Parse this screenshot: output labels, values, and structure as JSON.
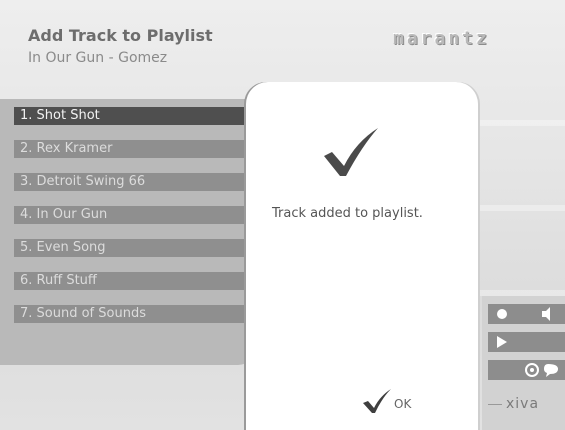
{
  "header": {
    "title": "Add Track to Playlist",
    "subtitle": "In Our Gun - Gomez",
    "brand": "marantz"
  },
  "tracks": [
    {
      "label": "1. Shot Shot",
      "selected": true
    },
    {
      "label": "2. Rex Kramer",
      "selected": false
    },
    {
      "label": "3. Detroit Swing 66",
      "selected": false
    },
    {
      "label": "4. In Our Gun",
      "selected": false
    },
    {
      "label": "5. Even Song",
      "selected": false
    },
    {
      "label": "6. Ruff Stuff",
      "selected": false
    },
    {
      "label": "7. Sound of Sounds",
      "selected": false
    }
  ],
  "dialog": {
    "message": "Track added to playlist.",
    "ok_label": "OK"
  },
  "side_panel": {
    "controls": [
      "record-icon",
      "volume-icon",
      "play-icon",
      "settings-icon",
      "speech-icon"
    ],
    "logo": "xiva"
  },
  "colors": {
    "selected_track": "#4f4f4f",
    "track": "#8f8f8f",
    "check": "#4a4a4a",
    "dialog_bg": "#ffffff"
  }
}
